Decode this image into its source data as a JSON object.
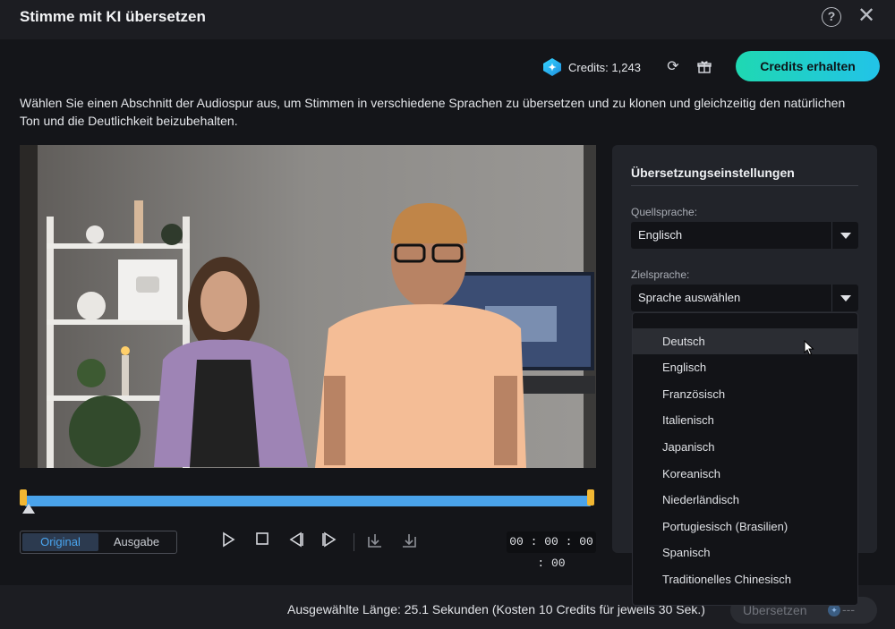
{
  "window": {
    "title": "Stimme mit KI übersetzen",
    "help_icon": "?",
    "close_icon": "✕"
  },
  "topbar": {
    "credits_label": "Credits: 1,243",
    "refresh_icon": "⟳",
    "gift_icon": "🎁",
    "cta_label": "Credits erhalten"
  },
  "description": "Wählen Sie einen Abschnitt der Audiospur aus, um Stimmen in verschiedene Sprachen zu übersetzen und zu klonen und gleichzeitig den natürlichen Ton und die Deutlichkeit beizubehalten.",
  "preview": {
    "selection_start": 0.0,
    "selection_end": 1.0,
    "playhead": 0.0
  },
  "view_toggle": {
    "original": "Original",
    "output": "Ausgabe",
    "active": "original"
  },
  "controls": {
    "timecode": "00 : 00 : 00 : 00",
    "play_icon": "▷",
    "stop_icon": "□",
    "prev_icon": "◁|",
    "next_icon": "|▷",
    "mark_in_icon": "mark-in",
    "mark_out_icon": "mark-out"
  },
  "settings": {
    "heading": "Übersetzungseinstellungen",
    "source_label": "Quellsprache:",
    "source_value": "Englisch",
    "target_label": "Zielsprache:",
    "target_value": "Sprache auswählen",
    "options": [
      "Deutsch",
      "Englisch",
      "Französisch",
      "Italienisch",
      "Japanisch",
      "Koreanisch",
      "Niederländisch",
      "Portugiesisch (Brasilien)",
      "Spanisch",
      "Traditionelles Chinesisch"
    ],
    "hovered_option": "Deutsch"
  },
  "footer": {
    "length_text": "Ausgewählte Länge: 25.1 Sekunden (Kosten 10 Credits für jeweils 30 Sek.)",
    "translate_label": "Übersetzen",
    "translate_cost": "---"
  },
  "colors": {
    "accent": "#4aa3ea",
    "cta_start": "#1fd8b2",
    "cta_end": "#22c3e8",
    "handle": "#f2b732"
  }
}
